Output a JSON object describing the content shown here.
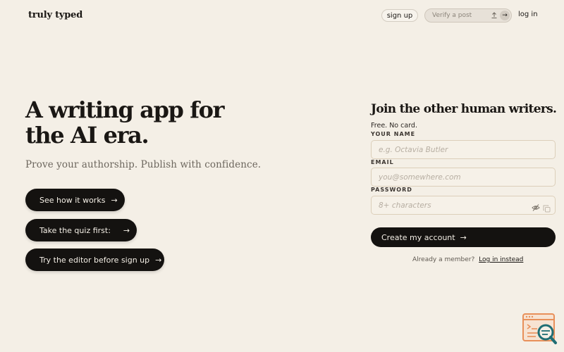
{
  "header": {
    "logo": "truly typed",
    "signup_label": "sign up",
    "verify_placeholder": "Verify a post",
    "verify_go": "→",
    "login_label": "log in"
  },
  "hero": {
    "title_line1": "A writing app for",
    "title_line2": "the AI era.",
    "subtitle": "Prove your authorship. Publish with confidence.",
    "buttons": [
      {
        "label": "See how it works",
        "arrow": "→"
      },
      {
        "label": "Take the quiz first:",
        "arrow": "→"
      },
      {
        "label": "Try the editor before sign up",
        "arrow": "→"
      }
    ]
  },
  "signup_form": {
    "title": "Join the other human writers.",
    "note": "Free. No card.",
    "name_label": "YOUR NAME",
    "name_placeholder": "e.g. Octavia Butler",
    "email_label": "EMAIL",
    "email_placeholder": "you@somewhere.com",
    "password_label": "PASSWORD",
    "password_placeholder": "8+ characters",
    "submit_label": "Create my account",
    "submit_arrow": "→",
    "already_text": "Already a member?",
    "login_instead": "Log in instead"
  },
  "icons": {
    "upload": "upload-icon",
    "password_toggle": "eye-off-icon",
    "copy": "copy-icon",
    "widget": "search-code-icon"
  },
  "colors": {
    "background": "#f4efe6",
    "button": "#141210",
    "accent": "#e8905a",
    "widget_teal": "#1f6e74"
  }
}
